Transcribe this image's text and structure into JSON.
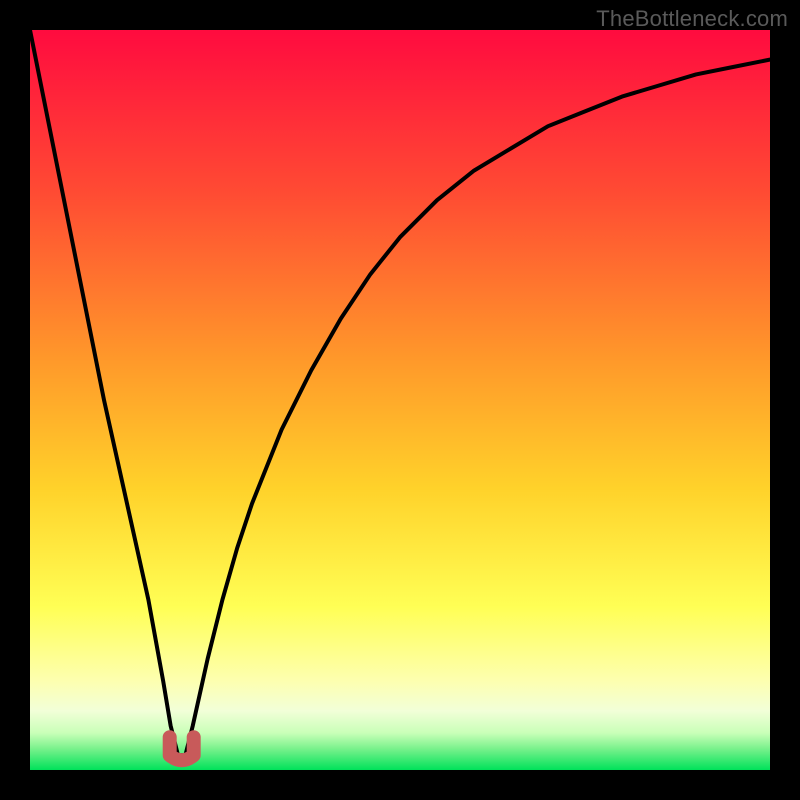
{
  "watermark": "TheBottleneck.com",
  "colors": {
    "top": "#ff0b3f",
    "mid_upper": "#ff6a2a",
    "mid": "#ffcc2a",
    "mid_lower": "#ffff55",
    "pale": "#f5ffcf",
    "green": "#00e25a",
    "curve": "#000000",
    "marker": "#c85a5a"
  },
  "chart_data": {
    "type": "line",
    "title": "",
    "xlabel": "",
    "ylabel": "",
    "xlim": [
      0,
      100
    ],
    "ylim": [
      0,
      100
    ],
    "x": [
      0,
      2,
      4,
      6,
      8,
      10,
      12,
      14,
      16,
      18,
      19,
      20,
      21,
      22,
      24,
      26,
      28,
      30,
      34,
      38,
      42,
      46,
      50,
      55,
      60,
      65,
      70,
      75,
      80,
      85,
      90,
      95,
      100
    ],
    "values": [
      100,
      90,
      80,
      70,
      60,
      50,
      41,
      32,
      23,
      12,
      6,
      2,
      2,
      6,
      15,
      23,
      30,
      36,
      46,
      54,
      61,
      67,
      72,
      77,
      81,
      84,
      87,
      89,
      91,
      92.5,
      94,
      95,
      96
    ],
    "annotations": [
      {
        "label": "min-marker",
        "x": 20.5,
        "y": 2
      }
    ]
  }
}
